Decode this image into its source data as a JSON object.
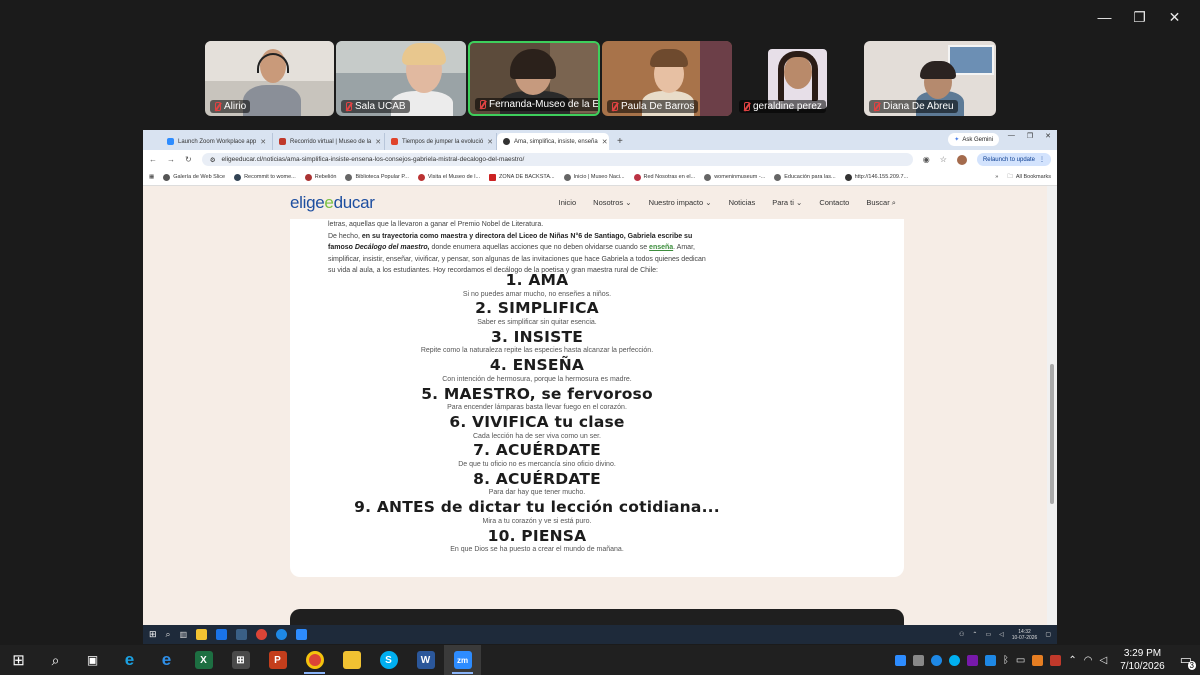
{
  "window": {
    "minimize": "—",
    "restore": "❐",
    "close": "✕"
  },
  "participants": [
    {
      "name": "Alirio"
    },
    {
      "name": "Sala UCAB"
    },
    {
      "name": "Fernanda-Museo de la Edu..."
    },
    {
      "name": "Paula De Barros"
    },
    {
      "name": "geraldine perez"
    },
    {
      "name": "Diana De Abreu"
    }
  ],
  "browser": {
    "tabs": [
      {
        "label": "Launch Zoom Workplace app"
      },
      {
        "label": "Recorrido virtual | Museo de la"
      },
      {
        "label": "Tiempos de jumper la evolució"
      },
      {
        "label": "Ama, simplifica, insiste, enseña"
      }
    ],
    "ask_gemini": "Ask Gemini",
    "url": "eligeeducar.cl/noticias/ama-simplifica-insiste-ensena-los-consejos-gabriela-mistral-decalogo-del-maestro/",
    "relaunch": "Relaunch to update",
    "bookmarks": [
      {
        "label": "Galería de Web Slice"
      },
      {
        "label": "Recommit to wome..."
      },
      {
        "label": "Rebelión"
      },
      {
        "label": "Biblioteca Popular P..."
      },
      {
        "label": "Visita el Museo de l..."
      },
      {
        "label": "ZONA DE BACKSTA..."
      },
      {
        "label": "Inicio | Museo Naci..."
      },
      {
        "label": "Red Nosotras en el..."
      },
      {
        "label": "womeninmuseum -..."
      },
      {
        "label": "Educación para las..."
      },
      {
        "label": "http://146.155.209.7..."
      }
    ],
    "all_bookmarks": "All Bookmarks"
  },
  "site": {
    "logo_a": "elige",
    "logo_b": "e",
    "logo_c": "ducar",
    "nav": [
      "Inicio",
      "Nosotros",
      "Nuestro impacto",
      "Noticias",
      "Para ti",
      "Contacto",
      "Buscar"
    ],
    "intro_1": "letras, aquellas que la llevaron a ganar el Premio Nobel de Literatura.",
    "intro_2a": "De hecho, ",
    "intro_2b": "en su trayectoria como maestra y directora del Liceo de Niñas N°6 de Santiago, Gabriela escribe su famoso ",
    "intro_2c": "Decálogo del maestro,",
    "intro_2d": " donde enumera aquellas acciones que no deben olvidarse cuando se ",
    "intro_link": "enseña",
    "intro_2e": ". Amar, simplificar, insistir, enseñar, vivificar, y pensar, son algunas de las invitaciones que hace Gabriela a todos quienes dedican su vida al aula, a los estudiantes. Hoy recordamos el decálogo de la poetisa y gran maestra rural de Chile:",
    "items": [
      {
        "title": "1. AMA",
        "text": "Si no puedes amar mucho, no enseñes a niños."
      },
      {
        "title": "2. SIMPLIFICA",
        "text": "Saber es simplificar sin quitar esencia."
      },
      {
        "title": "3. INSISTE",
        "text": "Repite como la naturaleza repite las especies hasta alcanzar la perfección."
      },
      {
        "title": "4. ENSEÑA",
        "text": "Con intención de hermosura, porque la hermosura es madre."
      },
      {
        "title": "5. MAESTRO, se fervoroso",
        "text": "Para encender lámparas basta llevar fuego en el corazón."
      },
      {
        "title": "6. VIVIFICA tu clase",
        "text": "Cada lección ha de ser viva como un ser."
      },
      {
        "title": "7. ACUÉRDATE",
        "text": "De que tu oficio no es mercancía sino oficio divino."
      },
      {
        "title": "8. ACUÉRDATE",
        "text": "Para dar hay que tener mucho."
      },
      {
        "title": "9. ANTES de dictar tu lección cotidiana...",
        "text": "Mira a tu corazón y ve si está puro."
      },
      {
        "title": "10. PIENSA",
        "text": "En que Dios se ha puesto a crear el mundo de mañana."
      }
    ]
  },
  "inner_taskbar": {
    "time": "14:32",
    "date": "10-07-2026"
  },
  "taskbar": {
    "time": "3:29 PM",
    "date": "7/10/2026",
    "notifications": "3"
  }
}
